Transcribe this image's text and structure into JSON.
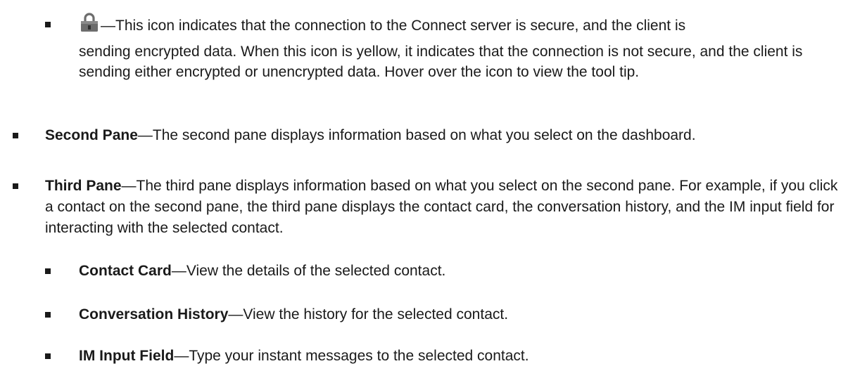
{
  "bullets": [
    {
      "icon": "lock-icon",
      "icon_color": "#6d6d6d",
      "text_line1": "—This icon indicates that the connection to the Connect server is secure, and the client is",
      "text_rest": "sending encrypted data. When this icon is yellow, it indicates that the connection is not secure, and the client is sending either encrypted or unencrypted data. Hover over the icon to view the tool tip."
    },
    {
      "term": "Second Pane",
      "desc": "—The second pane displays information based on what you select on the dashboard."
    },
    {
      "term": "Third Pane",
      "desc": "—The third pane displays information based on what you select on the second pane. For example, if you click a contact on the second pane, the third pane displays the contact card, the conversation history, and the IM input field for interacting with the selected contact."
    },
    {
      "term": "Contact Card",
      "desc": "—View the details of the selected contact."
    },
    {
      "term": "Conversation History",
      "desc": "—View the history for the selected contact."
    },
    {
      "term": "IM Input Field",
      "desc": "—Type your instant messages to the selected contact."
    }
  ]
}
